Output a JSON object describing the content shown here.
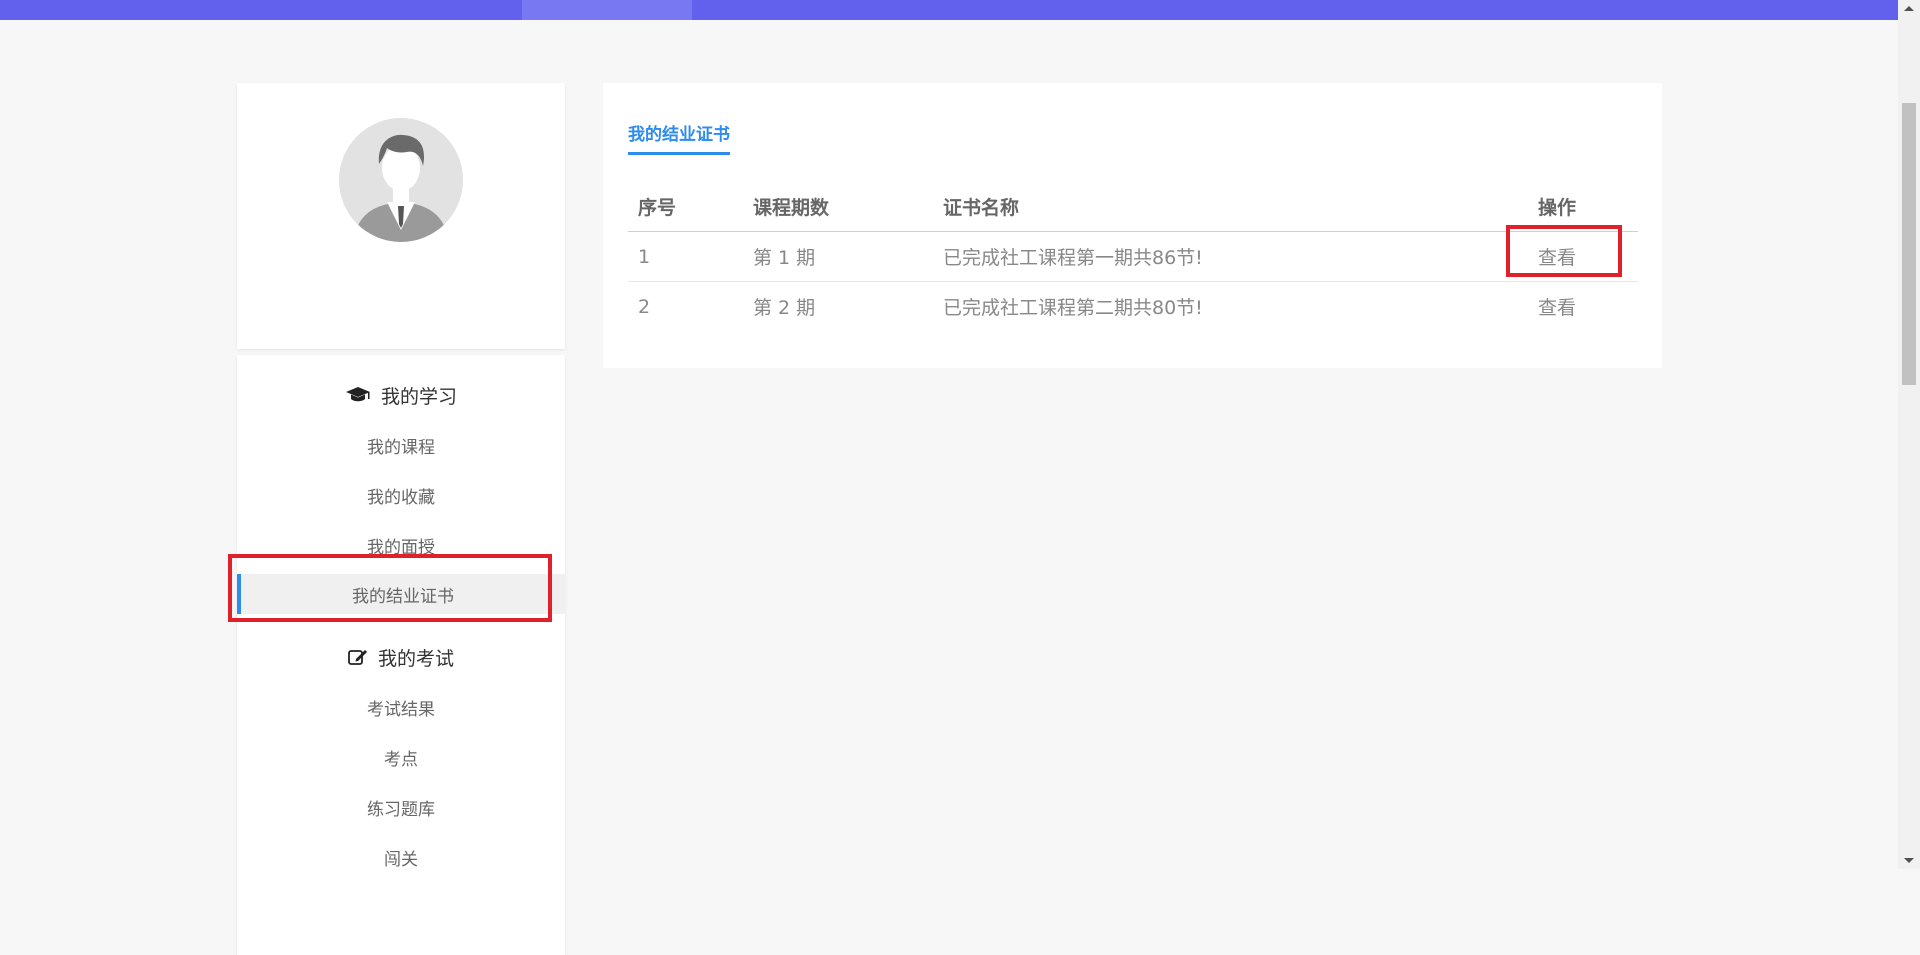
{
  "sidebar": {
    "groups": [
      {
        "label": "我的学习",
        "icon": "graduation-cap-icon",
        "items": [
          "我的课程",
          "我的收藏",
          "我的面授",
          "我的结业证书"
        ]
      },
      {
        "label": "我的考试",
        "icon": "edit-icon",
        "items": [
          "考试结果",
          "考点",
          "练习题库",
          "闯关"
        ]
      }
    ],
    "active_item": "我的结业证书"
  },
  "main": {
    "tab": "我的结业证书",
    "table": {
      "headers": [
        "序号",
        "课程期数",
        "证书名称",
        "操作"
      ],
      "rows": [
        [
          "1",
          "第 1 期",
          "已完成社工课程第一期共86节!",
          "查看"
        ],
        [
          "2",
          "第 2 期",
          "已完成社工课程第二期共80节!",
          "查看"
        ]
      ]
    }
  },
  "colors": {
    "topbar": "#6161ee",
    "accent": "#2d8cf0",
    "highlight": "#e0202a"
  }
}
